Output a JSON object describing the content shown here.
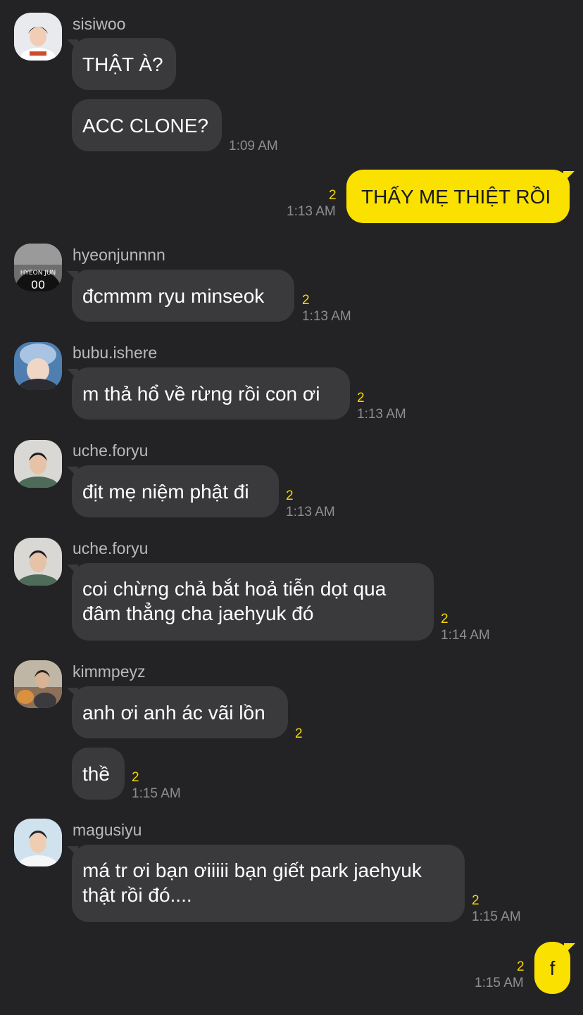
{
  "messages": {
    "m1": {
      "sender": "sisiwoo",
      "lines": [
        "THẬT À?",
        "ACC CLONE?"
      ],
      "time": "1:09 AM"
    },
    "m2": {
      "text": "THẤY MẸ THIỆT RỒI",
      "unread": "2",
      "time": "1:13 AM"
    },
    "m3": {
      "sender": "hyeonjunnnn",
      "text": "đcmmm ryu minseok",
      "unread": "2",
      "time": "1:13 AM"
    },
    "m4": {
      "sender": "bubu.ishere",
      "text": "m thả hổ về rừng rồi con ơi",
      "unread": "2",
      "time": "1:13 AM"
    },
    "m5": {
      "sender": "uche.foryu",
      "text": "địt mẹ niệm phật đi",
      "unread": "2",
      "time": "1:13 AM"
    },
    "m6": {
      "sender": "uche.foryu",
      "line1": "coi chừng chả bắt hoả tiễn dọt qua",
      "line2": "đâm thẳng cha jaehyuk đó",
      "unread": "2",
      "time": "1:14 AM"
    },
    "m7": {
      "sender": "kimmpeyz",
      "text1": "anh ơi anh ác vãi lồn",
      "unread1": "2",
      "text2": "thề",
      "unread2": "2",
      "time": "1:15 AM"
    },
    "m8": {
      "sender": "magusiyu",
      "line1": "má tr ơi bạn ơiiiii bạn giết park jaehyuk",
      "line2": "thật rồi đó....",
      "unread": "2",
      "time": "1:15 AM"
    },
    "m9": {
      "text": "f",
      "unread": "2",
      "time": "1:15 AM"
    }
  },
  "colors": {
    "background": "#232325",
    "incoming_bubble": "#3a3a3d",
    "outgoing_bubble": "#fae100",
    "unread_count": "#f5d800",
    "timestamp": "#8e8e92"
  },
  "icons": {
    "avatar": "profile-photo"
  }
}
